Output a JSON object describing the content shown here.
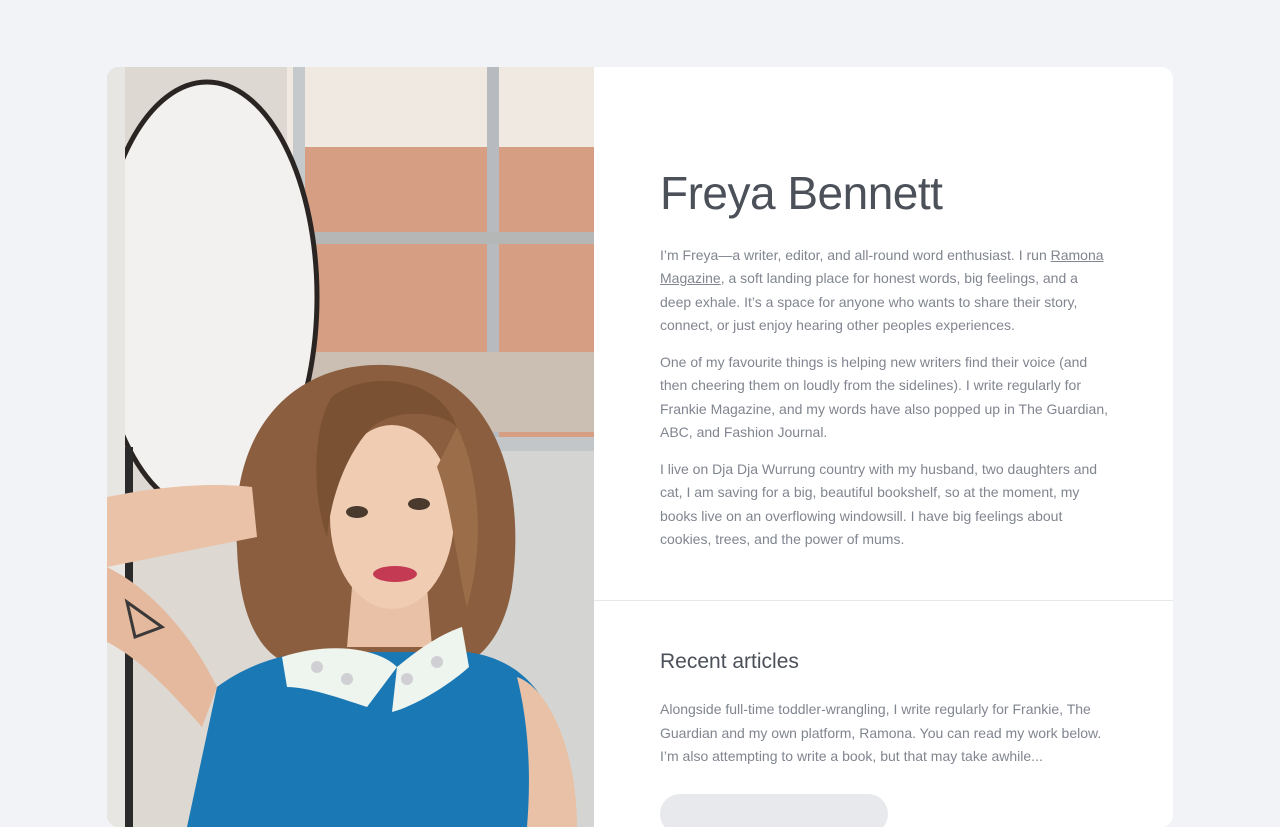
{
  "profile": {
    "name": "Freya Bennett",
    "photo_alt": "Portrait of Freya Bennett",
    "bio": {
      "p1_before": "I’m Freya—a writer, editor, and all-round word enthusiast. I run ",
      "p1_link": "Ramona Magazine",
      "p1_after": ", a soft landing place for honest words, big feelings, and a deep exhale. It’s a space for anyone who wants to share their story, connect, or just enjoy hearing other peoples experiences.",
      "p2": "One of my favourite things is helping new writers find their voice (and then cheering them on loudly from the sidelines). I write regularly for Frankie Magazine, and my words have also popped up in The Guardian, ABC, and Fashion Journal.",
      "p3": "I live on Dja Dja Wurrung country with my husband, two daughters and cat, I am saving for a big, beautiful bookshelf, so at the moment, my books live on an overflowing windowsill. I have big feelings about cookies, trees, and the power of mums."
    }
  },
  "recent_articles": {
    "heading": "Recent articles",
    "description": "Alongside full-time toddler-wrangling, I write regularly for Frankie, The Guardian and my own platform, Ramona. You can read my work below. I’m also attempting to write a book, but that may take awhile..."
  }
}
